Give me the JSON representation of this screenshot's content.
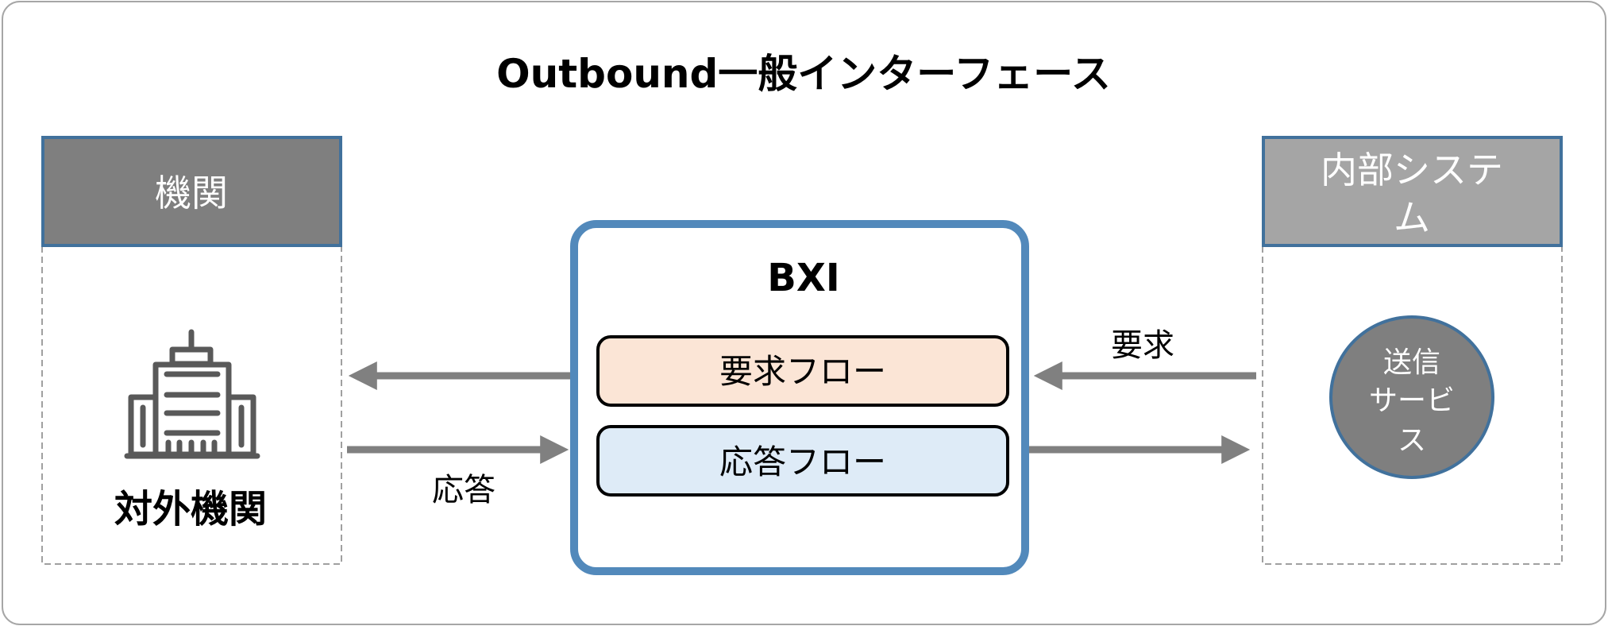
{
  "title": "Outbound一般インターフェース",
  "colors": {
    "panel_header_left": "#7f7f7f",
    "panel_header_right": "#a5a5a5",
    "panel_border": "#41719c",
    "bxi_border": "#5289bb",
    "request_flow_fill": "#fbe5d6",
    "response_flow_fill": "#deebf7",
    "arrow": "#808080",
    "icon": "#595959",
    "service_fill": "#7f7f7f"
  },
  "left_panel": {
    "header": "機関",
    "icon": "office-building-icon",
    "label": "対外機関"
  },
  "center": {
    "label": "BXI",
    "flows": [
      {
        "label": "要求フロー",
        "kind": "request"
      },
      {
        "label": "応答フロー",
        "kind": "response"
      }
    ]
  },
  "right_panel": {
    "header_lines": [
      "内部システ",
      "ム"
    ],
    "service_lines": [
      "送信",
      "サービ",
      "ス"
    ]
  },
  "arrows": {
    "left_label": "応答",
    "right_label": "要求"
  }
}
